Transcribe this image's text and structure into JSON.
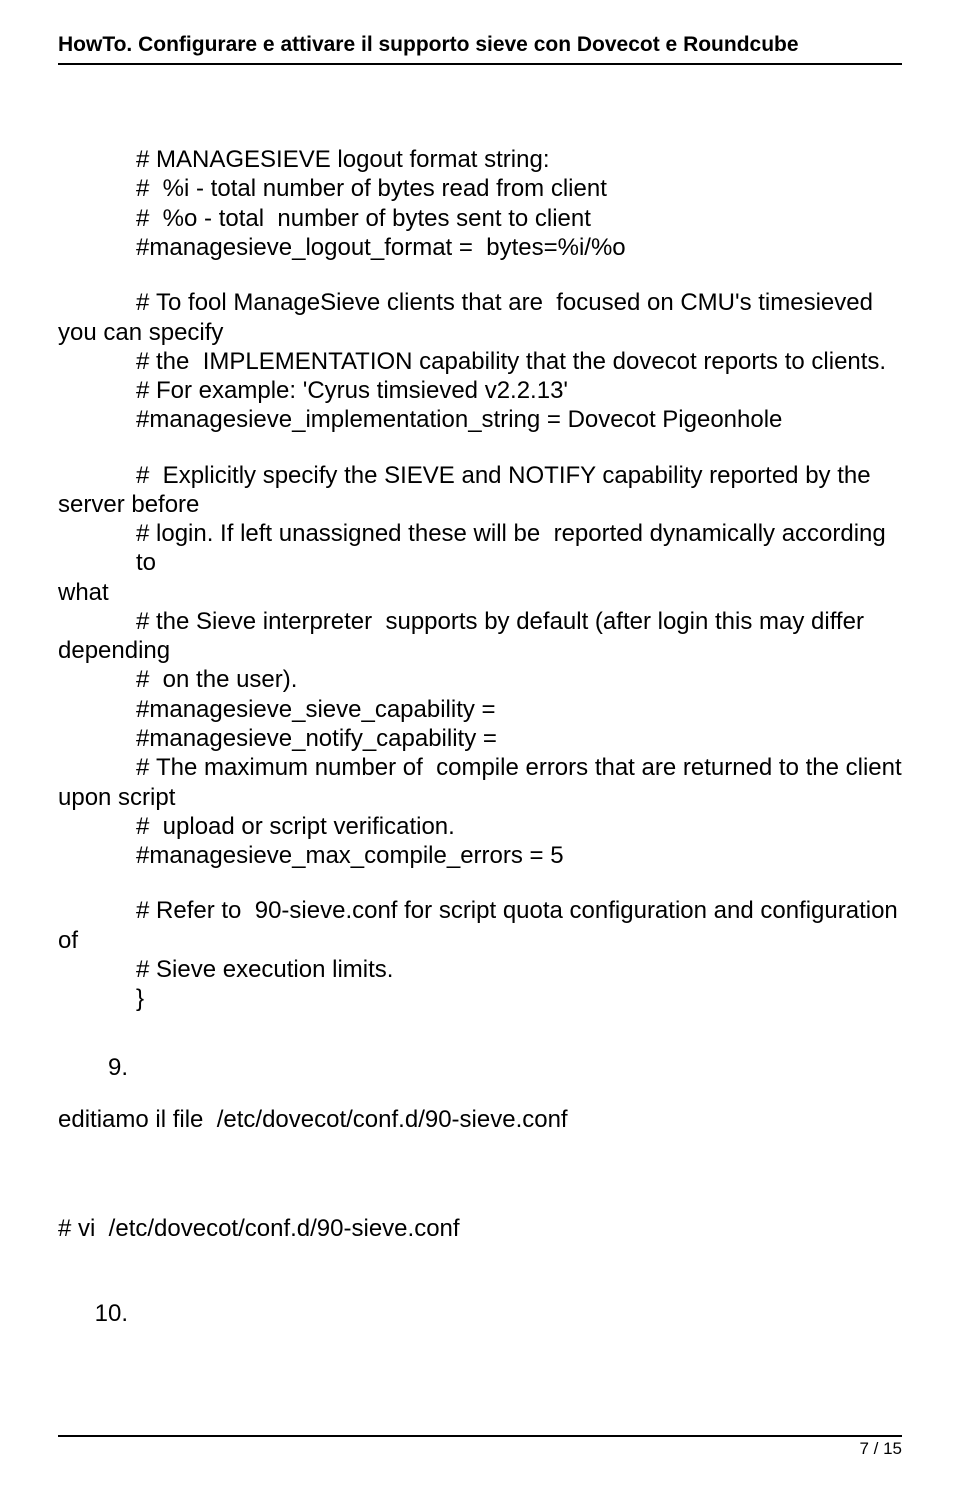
{
  "header": {
    "title": "HowTo. Configurare e attivare il supporto sieve con Dovecot e Roundcube"
  },
  "body": {
    "p1": {
      "l1": "# MANAGESIEVE logout format string:",
      "l2": "#  %i - total number of bytes read from client",
      "l3": "#  %o - total  number of bytes sent to client",
      "l4": "#managesieve_logout_format =  bytes=%i/%o"
    },
    "p2": {
      "l1": "# To fool ManageSieve clients that are  focused on CMU's timesieved",
      "l2": "you can specify",
      "l3": "# the  IMPLEMENTATION capability that the dovecot reports to clients.",
      "l4": "# For example: 'Cyrus timsieved v2.2.13'",
      "l5": "#managesieve_implementation_string = Dovecot Pigeonhole"
    },
    "p3": {
      "l1": "#  Explicitly specify the SIEVE and NOTIFY capability reported by the",
      "l2": "server before",
      "l3": "# login. If left unassigned these will be  reported dynamically according to",
      "l4": "what",
      "l5": "# the Sieve interpreter  supports by default (after login this may differ",
      "l6": "depending",
      "l7": "#  on the user).",
      "l8": "#managesieve_sieve_capability =",
      "l9": "#managesieve_notify_capability =",
      "l10": "# The maximum number of  compile errors that are returned to the client",
      "l11": "upon script",
      "l12": "#  upload or script verification.",
      "l13": "#managesieve_max_compile_errors = 5"
    },
    "p4": {
      "l1": "# Refer to  90-sieve.conf for script quota configuration and configuration",
      "l2": "of",
      "l3": "# Sieve execution limits.",
      "l4": "}"
    },
    "step9": {
      "marker": "9.",
      "text": "editiamo il file  /etc/dovecot/conf.d/90-sieve.conf"
    },
    "cmd9": "# vi  /etc/dovecot/conf.d/90-sieve.conf",
    "step10": {
      "marker": "10."
    }
  },
  "footer": {
    "pagenum": "7 / 15"
  }
}
